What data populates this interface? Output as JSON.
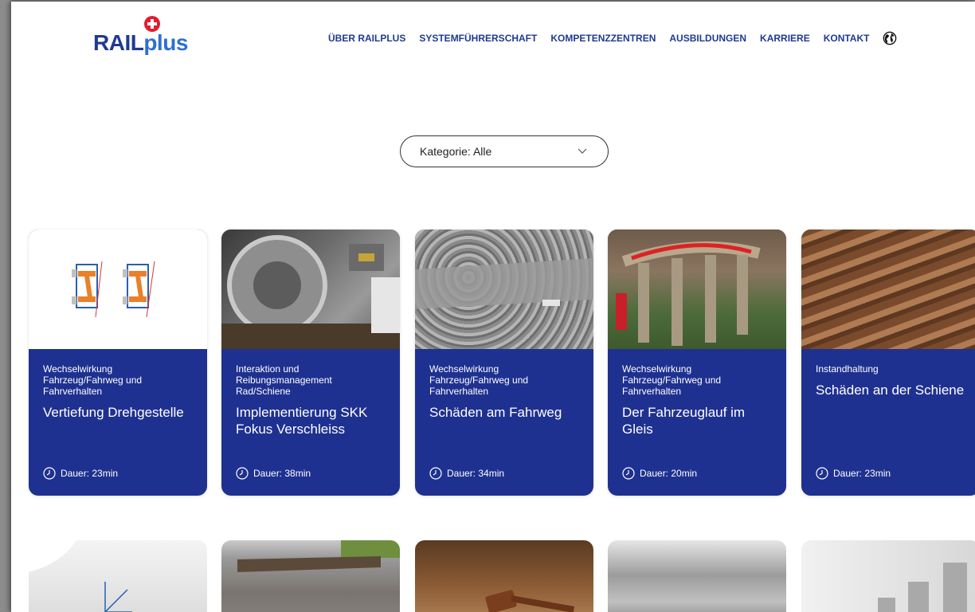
{
  "header": {
    "logo_rail": "RAIL",
    "logo_plus": "plus",
    "nav": [
      "ÜBER RAILPLUS",
      "SYSTEMFÜHRERSCHAFT",
      "KOMPETENZZENTREN",
      "AUSBILDUNGEN",
      "KARRIERE",
      "KONTAKT"
    ],
    "globe_icon": "globe-icon"
  },
  "filter": {
    "label": "Kategorie: Alle",
    "icon": "chevron-down-icon"
  },
  "colors": {
    "brand_blue": "#1f3190",
    "logo_blue": "#1f3a93",
    "logo_red": "#e01e2f"
  },
  "cards": [
    {
      "category": "Wechselwirkung Fahrzeug/Fahrweg und Fahrverhalten",
      "title": "Vertiefung Drehgestelle",
      "duration": "Dauer: 23min"
    },
    {
      "category": "Interaktion und Reibungsmanagement Rad/Schiene",
      "title": "Implementierung SKK Fokus Verschleiss",
      "duration": "Dauer: 38min"
    },
    {
      "category": "Wechselwirkung Fahrzeug/Fahrweg und Fahrverhalten",
      "title": "Schäden am Fahrweg",
      "duration": "Dauer: 34min"
    },
    {
      "category": "Wechselwirkung Fahrzeug/Fahrweg und Fahrverhalten",
      "title": "Der Fahrzeuglauf im Gleis",
      "duration": "Dauer: 20min"
    },
    {
      "category": "Instandhaltung",
      "title": "Schäden an der Schiene",
      "duration": "Dauer: 23min"
    }
  ]
}
